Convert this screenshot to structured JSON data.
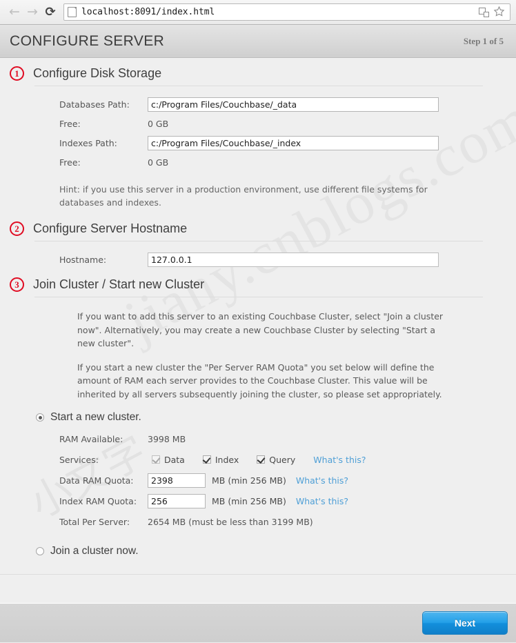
{
  "browser": {
    "back_icon": "arrow-left-icon",
    "forward_icon": "arrow-right-icon",
    "reload_icon": "reload-icon",
    "reload_glyph": "⟳",
    "back_glyph": "←",
    "forward_glyph": "→",
    "url": "localhost:8091/index.html",
    "translate_icon": "translate-icon",
    "bookmark_icon": "star-icon"
  },
  "header": {
    "title": "CONFIGURE SERVER",
    "step": "Step 1 of 5"
  },
  "watermark": {
    "line1": "jiany.cnblogs.com",
    "line2": "小文字"
  },
  "sections": [
    {
      "number": "1",
      "title": "Configure Disk Storage",
      "fields": {
        "databases_path_label": "Databases Path:",
        "databases_path_value": "c:/Program Files/Couchbase/_data",
        "databases_free_label": "Free:",
        "databases_free_value": "0 GB",
        "indexes_path_label": "Indexes Path:",
        "indexes_path_value": "c:/Program Files/Couchbase/_index",
        "indexes_free_label": "Free:",
        "indexes_free_value": "0 GB"
      },
      "hint": "Hint: if you use this server in a production environment, use different file systems for databases and indexes."
    },
    {
      "number": "2",
      "title": "Configure Server Hostname",
      "fields": {
        "hostname_label": "Hostname:",
        "hostname_value": "127.0.0.1"
      }
    },
    {
      "number": "3",
      "title": "Join Cluster / Start new Cluster",
      "paragraphs": [
        "If you want to add this server to an existing Couchbase Cluster, select \"Join a cluster now\". Alternatively, you may create a new Couchbase Cluster by selecting \"Start a new cluster\".",
        "If you start a new cluster the \"Per Server RAM Quota\" you set below will define the amount of RAM each server provides to the Couchbase Cluster. This value will be inherited by all servers subsequently joining the cluster, so please set appropriately."
      ],
      "start_cluster": {
        "radio_label": "Start a new cluster.",
        "selected": true,
        "ram_available_label": "RAM Available:",
        "ram_available_value": "3998 MB",
        "services_label": "Services:",
        "services": [
          {
            "label": "Data",
            "checked": true,
            "disabled": true
          },
          {
            "label": "Index",
            "checked": true,
            "disabled": false
          },
          {
            "label": "Query",
            "checked": true,
            "disabled": false
          }
        ],
        "services_help": "What's this?",
        "data_quota_label": "Data RAM Quota:",
        "data_quota_value": "2398",
        "data_quota_unit": "MB (min 256 MB)",
        "data_quota_help": "What's this?",
        "index_quota_label": "Index RAM Quota:",
        "index_quota_value": "256",
        "index_quota_unit": "MB (min 256 MB)",
        "index_quota_help": "What's this?",
        "total_label": "Total Per Server:",
        "total_value": "2654 MB (must be less than 3199 MB)"
      },
      "join_cluster": {
        "radio_label": "Join a cluster now.",
        "selected": false
      }
    }
  ],
  "footer": {
    "next_label": "Next"
  },
  "colors": {
    "badge_red": "#e00b22",
    "link_blue": "#4e9fd6",
    "button_blue": "#23a0e8"
  }
}
